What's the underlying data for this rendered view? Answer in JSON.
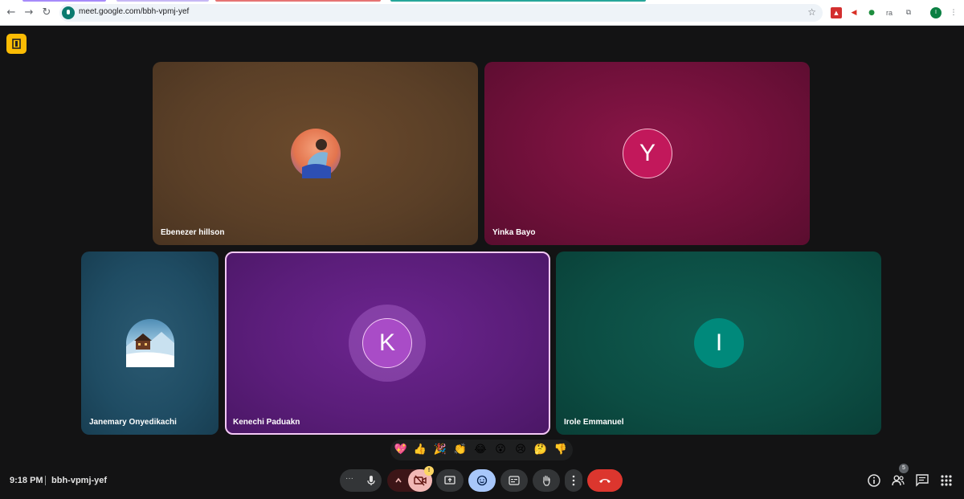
{
  "browser": {
    "url": "meet.google.com/bbh-vpmj-yef",
    "profile_initial": "I",
    "extensions": [
      "pdf-icon",
      "megaphone-icon",
      "google-green-icon",
      "ra-extension",
      "puzzle-icon"
    ],
    "ext_ra_label": "ra"
  },
  "participants": [
    {
      "name": "Ebenezer hillson",
      "initial": "",
      "color": "#5a3f27"
    },
    {
      "name": "Yinka Bayo",
      "initial": "Y",
      "color": "#c2185b"
    },
    {
      "name": "Janemary Onyedikachi",
      "initial": "",
      "color": "#1f4c63"
    },
    {
      "name": "Kenechi Paduakn",
      "initial": "K",
      "color": "#a94cc7"
    },
    {
      "name": "Irole Emmanuel",
      "initial": "I",
      "color": "#00897b"
    }
  ],
  "reactions": [
    "💖",
    "👍",
    "🎉",
    "👏",
    "😂",
    "😮",
    "😢",
    "🤔",
    "👎"
  ],
  "footer": {
    "time": "9:18 PM",
    "separator": "|",
    "meeting_code": "bbh-vpmj-yef",
    "camera_warning": "!",
    "people_count": "5",
    "more_label": "···"
  },
  "colors": {
    "accent_blue": "#a8c7fa",
    "end_call_red": "#dc362e",
    "camera_off_pink": "#f2b8b5",
    "active_speaker_border": "#f3c8f5"
  }
}
